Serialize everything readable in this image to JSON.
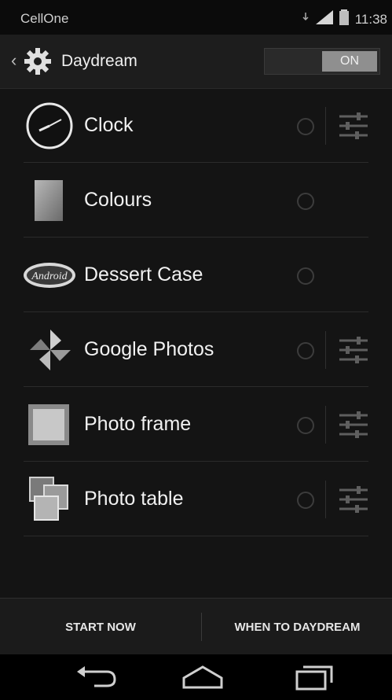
{
  "status_bar": {
    "carrier": "CellOne",
    "time": "11:38"
  },
  "action_bar": {
    "title": "Daydream",
    "toggle_label": "ON"
  },
  "list": {
    "items": [
      {
        "label": "Clock",
        "icon": "clock-icon",
        "has_settings": true
      },
      {
        "label": "Colours",
        "icon": "colours-icon",
        "has_settings": false
      },
      {
        "label": "Dessert Case",
        "icon": "dessert-case-icon",
        "icon_text": "Android",
        "has_settings": false
      },
      {
        "label": "Google Photos",
        "icon": "pinwheel-icon",
        "has_settings": true
      },
      {
        "label": "Photo frame",
        "icon": "photo-frame-icon",
        "has_settings": true
      },
      {
        "label": "Photo table",
        "icon": "photo-table-icon",
        "has_settings": true
      }
    ]
  },
  "bottom_bar": {
    "start_label": "START NOW",
    "when_label": "WHEN TO DAYDREAM"
  },
  "nav_bar": {
    "buttons": [
      "back-icon",
      "home-icon",
      "recents-icon"
    ]
  },
  "colors": {
    "background": "#141414",
    "text": "#f1f1f1",
    "toggle_on": "#8f8f8f"
  }
}
